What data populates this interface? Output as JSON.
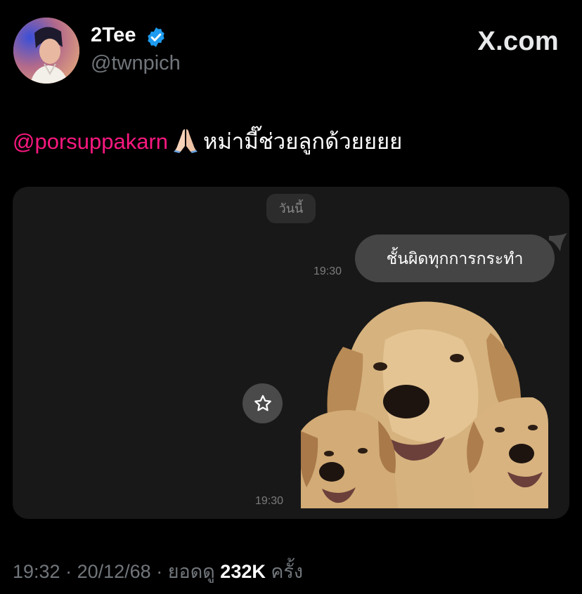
{
  "author": {
    "display_name": "2Tee",
    "handle": "@twnpich",
    "verified": true
  },
  "brand": "X.com",
  "tweet": {
    "mention": "@porsuppakarn",
    "emoji_icon": "folded-hands",
    "text": "หม่ามี๊ช่วยลูกด้วยยยย"
  },
  "chat": {
    "date_label": "วันนี้",
    "message_text": "ชั้นผิดทุกการกระทำ",
    "message_time": "19:30",
    "sticker_icon": "golden-retriever-sticker",
    "sticker_time": "19:30"
  },
  "footer": {
    "time": "19:32",
    "sep1": " · ",
    "date": "20/12/68",
    "sep2": " · ",
    "views_label": "ยอดดู ",
    "views": "232K",
    "views_suffix": " ครั้ง"
  },
  "colors": {
    "mention": "#f91880",
    "verified": "#1d9bf0",
    "muted": "#71767b",
    "bubble": "#454545",
    "card": "#181818"
  }
}
